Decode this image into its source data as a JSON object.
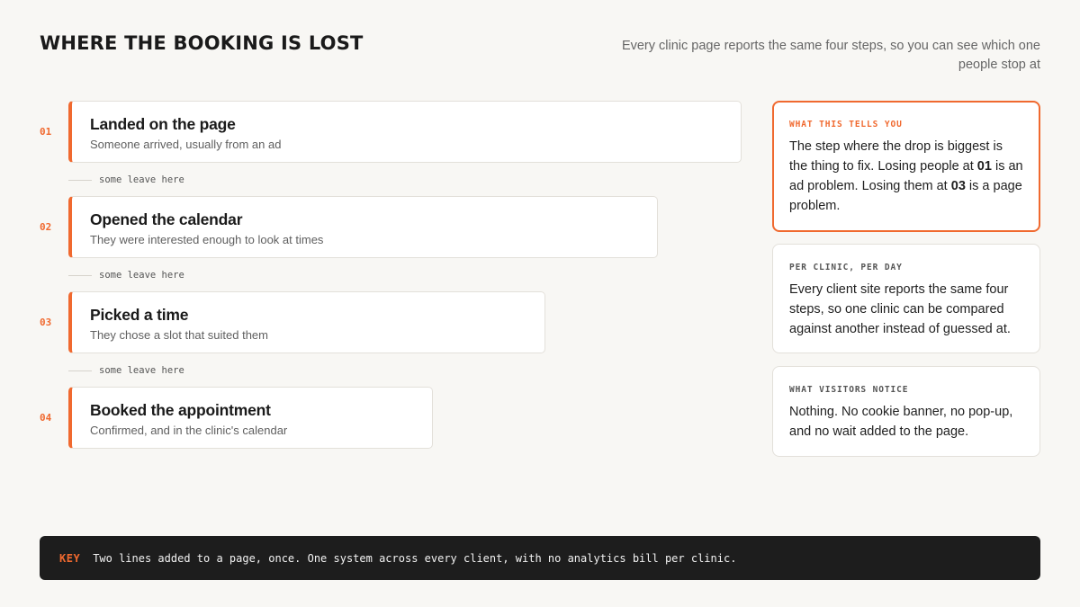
{
  "header": {
    "title": "WHERE THE BOOKING IS LOST",
    "subtitle": "Every clinic page reports the same four steps, so you can see which one people stop at"
  },
  "steps": [
    {
      "number": "01",
      "title": "Landed on the page",
      "description": "Someone arrived, usually from an ad"
    },
    {
      "number": "02",
      "title": "Opened the calendar",
      "description": "They were interested enough to look at times"
    },
    {
      "number": "03",
      "title": "Picked a time",
      "description": "They chose a slot that suited them"
    },
    {
      "number": "04",
      "title": "Booked the appointment",
      "description": "Confirmed, and in the clinic's calendar"
    }
  ],
  "dropoff_label": "some leave here",
  "panels": [
    {
      "heading": "WHAT THIS TELLS YOU",
      "body_parts": [
        "The step where the drop is biggest is the thing to fix. Losing people at ",
        "01",
        " is an ad problem. Losing them at ",
        "03",
        " is a page problem."
      ]
    },
    {
      "heading": "PER CLINIC, PER DAY",
      "body": "Every client site reports the same four steps, so one clinic can be compared against another instead of guessed at."
    },
    {
      "heading": "WHAT VISITORS NOTICE",
      "body": "Nothing. No cookie banner, no pop-up, and no wait added to the page."
    }
  ],
  "key": {
    "label": "KEY",
    "text": "Two lines added to a page, once. One system across every client, with no analytics bill per clinic."
  },
  "colors": {
    "accent": "#f0692f",
    "background": "#f8f7f4",
    "key_bar": "#1d1d1d"
  }
}
